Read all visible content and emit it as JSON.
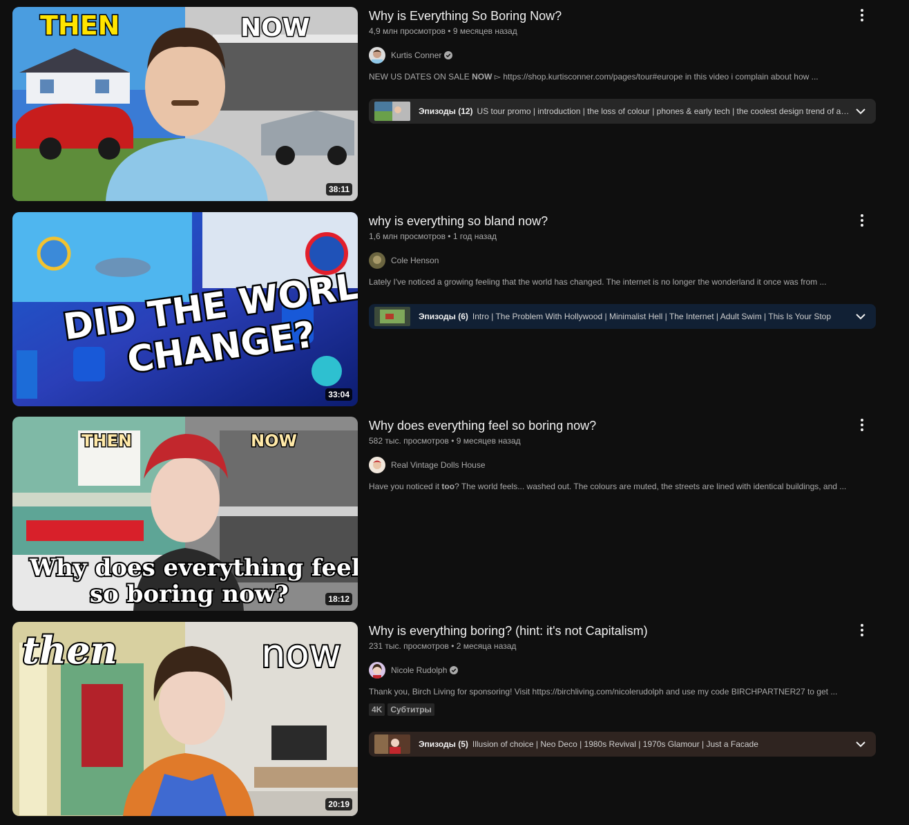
{
  "videos": [
    {
      "title": "Why is Everything So Boring Now?",
      "views": "4,9 млн просмотров",
      "age": "9 месяцев назад",
      "channel": "Kurtis Conner",
      "verified": true,
      "description_pre": "NEW US DATES ON SALE ",
      "description_bold": "NOW",
      "description_post": " ▻ https://shop.kurtisconner.com/pages/tour#europe in this video i complain about how ...",
      "duration": "38:11",
      "thumb_text_left": "THEN",
      "thumb_text_right": "NOW",
      "episodes_label": "Эпизоды (12)",
      "episodes_list": "US tour promo | introduction | the loss of colour | phones & early tech | the coolest design trend of all time | ...",
      "episodes_bg": "#272727"
    },
    {
      "title": "why is everything so bland now?",
      "views": "1,6 млн просмотров",
      "age": "1 год назад",
      "channel": "Cole Henson",
      "verified": false,
      "description_pre": "Lately I've noticed a growing feeling that the world has changed. The internet is no longer the wonderland it once was from ...",
      "description_bold": "",
      "description_post": "",
      "duration": "33:04",
      "thumb_text_line1": "DID THE WORLD",
      "thumb_text_line2": "CHANGE?",
      "episodes_label": "Эпизоды (6)",
      "episodes_list": "Intro | The Problem With Hollywood | Minimalist Hell | The Internet | Adult Swim | This Is Your Stop",
      "episodes_bg": "#112034"
    },
    {
      "title": "Why does everything feel so boring now?",
      "views": "582 тыс. просмотров",
      "age": "9 месяцев назад",
      "channel": "Real Vintage Dolls House",
      "verified": false,
      "description_pre": "Have you noticed it ",
      "description_bold": "too",
      "description_post": "? The world feels... washed out. The colours are muted, the streets are lined with identical buildings, and ...",
      "duration": "18:12",
      "thumb_text_left": "THEN",
      "thumb_text_right": "NOW",
      "thumb_text_line1": "Why does everything feel",
      "thumb_text_line2": "so boring now?"
    },
    {
      "title": "Why is everything boring? (hint: it's not Capitalism)",
      "views": "231 тыс. просмотров",
      "age": "2 месяца назад",
      "channel": "Nicole Rudolph",
      "verified": true,
      "description_pre": "Thank you, Birch Living for sponsoring! Visit https://birchliving.com/nicolerudolph and use my code BIRCHPARTNER27 to get ...",
      "description_bold": "",
      "description_post": "",
      "badges": [
        "4K",
        "Субтитры"
      ],
      "duration": "20:19",
      "thumb_text_left": "then",
      "thumb_text_right": "now",
      "episodes_label": "Эпизоды (5)",
      "episodes_list": "Illusion of choice | Neo Deco | 1980s Revival | 1970s Glamour | Just a Facade",
      "episodes_bg": "#2f2420"
    }
  ],
  "icons": {
    "menu": "more-vert-icon",
    "chevron": "chevron-down-icon",
    "verified": "verified-check-icon"
  }
}
